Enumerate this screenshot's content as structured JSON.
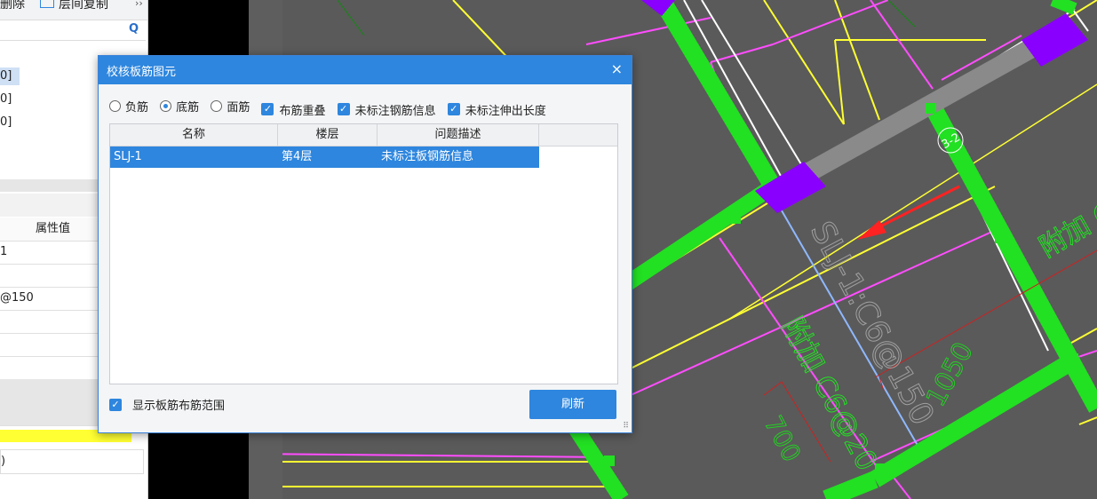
{
  "left_panel": {
    "toolbar": {
      "delete_label": "删除",
      "copy_label": "层间复制"
    },
    "tree_items": [
      "0]",
      "0]",
      "0]"
    ],
    "props_header": {
      "value_col": "属性值"
    },
    "prop_values": [
      "1",
      "",
      "@150",
      "",
      "",
      "",
      "",
      "",
      ")"
    ]
  },
  "dialog": {
    "title": "校核板筋图元",
    "close": "×",
    "options": {
      "neg_label": "负筋",
      "bottom_label": "底筋",
      "top_label": "面筋",
      "overlap_label": "布筋重叠",
      "unmarked_info_label": "未标注钢筋信息",
      "unmarked_length_label": "未标注伸出长度"
    },
    "table": {
      "headers": [
        "名称",
        "楼层",
        "问题描述"
      ],
      "rows": [
        [
          "SLJ-1",
          "第4层",
          "未标注板钢筋信息"
        ]
      ]
    },
    "show_range_label": "显示板筋布筋范围",
    "refresh_label": "刷新"
  },
  "drawing": {
    "label_main": "SLJ-1:C6@150",
    "label_add1": "附加 C6@20",
    "label_add2": "附加 C",
    "dim_1050": "1050",
    "dim_700": "700",
    "mark_3_2": "3-2"
  },
  "colors": {
    "accent": "#2e86de",
    "canvas": "#5a5a5a",
    "beam": "#22e022",
    "rebar_magenta": "#ff4dff",
    "rebar_yellow": "#ffff33",
    "column_purple": "#8a00ff",
    "arrow_red": "#ff2222",
    "dim_green": "#22d022"
  }
}
